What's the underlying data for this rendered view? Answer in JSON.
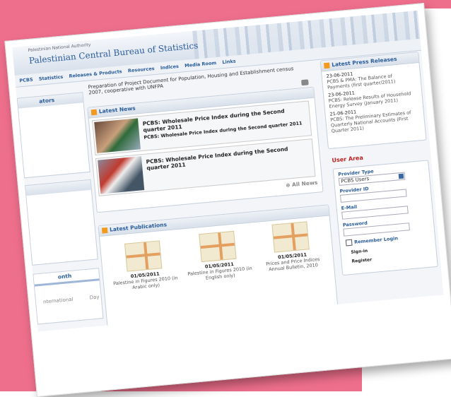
{
  "header": {
    "org_name_small": "Palestinian National Authority",
    "title": "Palestinian Central Bureau of Statistics"
  },
  "nav": [
    "PCBS",
    "Statistics",
    "Releases & Products",
    "Resources",
    "Indices",
    "Media Room",
    "Links"
  ],
  "left": {
    "indicators_title": "ators",
    "month_title": "onth",
    "footer_left": "nternational",
    "footer_right": "Day"
  },
  "intro": "Preparation of Project Document for Population, Housing and Establishment census 2007, cooperative with UNFPA",
  "latest_news": {
    "title": "Latest News",
    "items": [
      {
        "title": "PCBS: Wholesale Price Index during the Second quarter 2011",
        "subtitle": "PCBS: Wholesale Price Index during the Second quarter 2011"
      },
      {
        "title": "PCBS: Wholesale Price Index during the Second quarter 2011",
        "subtitle": ""
      }
    ],
    "all_news": "All News"
  },
  "press": {
    "title": "Latest Press Releases",
    "items": [
      {
        "date": "23-06-2011",
        "text": "PCBS & PMA: The Balance of Payments (first quarter/2011)"
      },
      {
        "date": "23-06-2011",
        "text": "PCBS: Release Results of Household Energy Survey (January 2011)"
      },
      {
        "date": "21-06-2011",
        "text": "PCBS: The Preliminary Estimates of Quarterly National Accounts (First Quarter 2011)"
      }
    ]
  },
  "user_area": {
    "title": "User Area",
    "provider_type_label": "Provider Type",
    "provider_type_value": "PCBS Users",
    "provider_id_label": "Provider ID",
    "email_label": "E-Mail",
    "password_label": "Password",
    "remember_label": "Remember Login",
    "signin": "Sign-in",
    "register": "Register"
  },
  "publications": {
    "title": "Latest Publications",
    "items": [
      {
        "date": "01/05/2011",
        "title": "Palestine in Figures 2010 (in Arabic only)"
      },
      {
        "date": "01/05/2011",
        "title": "Palestine in Figures 2010 (in English only)"
      },
      {
        "date": "01/05/2011",
        "title": "Prices and Price Indices Annual Bulletin, 2010"
      }
    ]
  }
}
